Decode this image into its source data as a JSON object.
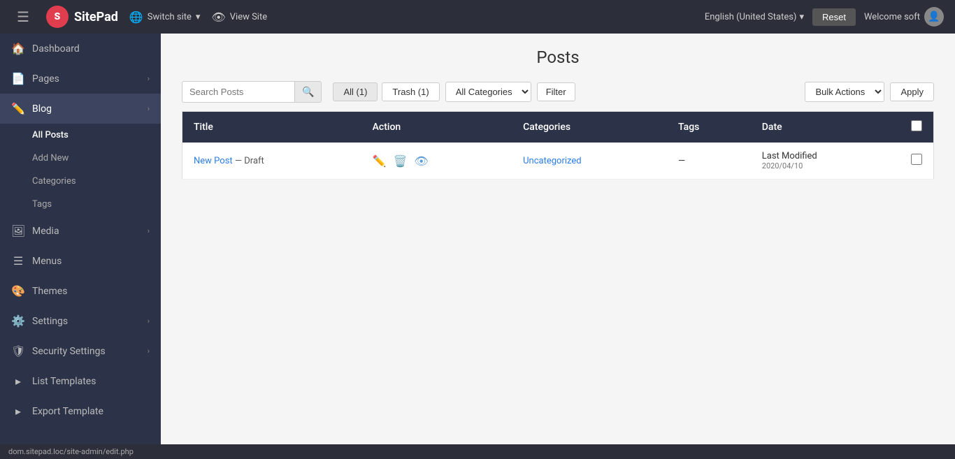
{
  "topnav": {
    "logo_text": "SitePad",
    "logo_letter": "S",
    "switch_site_label": "Switch site",
    "view_site_label": "View Site",
    "lang_label": "English (United States)",
    "reset_label": "Reset",
    "welcome_label": "Welcome soft"
  },
  "sidebar": {
    "items": [
      {
        "id": "dashboard",
        "icon": "🏠",
        "label": "Dashboard",
        "has_arrow": false
      },
      {
        "id": "pages",
        "icon": "📄",
        "label": "Pages",
        "has_arrow": true
      },
      {
        "id": "blog",
        "icon": "✏️",
        "label": "Blog",
        "has_arrow": true
      }
    ],
    "blog_sub": [
      {
        "id": "all-posts",
        "label": "All Posts",
        "active": true
      },
      {
        "id": "add-new",
        "label": "Add New"
      },
      {
        "id": "categories",
        "label": "Categories"
      },
      {
        "id": "tags",
        "label": "Tags"
      }
    ],
    "items2": [
      {
        "id": "media",
        "icon": "🖼",
        "label": "Media",
        "has_arrow": true
      },
      {
        "id": "menus",
        "icon": "☰",
        "label": "Menus",
        "has_arrow": false
      },
      {
        "id": "themes",
        "icon": "🎨",
        "label": "Themes",
        "has_arrow": false
      },
      {
        "id": "settings",
        "icon": "⚙️",
        "label": "Settings",
        "has_arrow": true
      },
      {
        "id": "security",
        "icon": "🛡",
        "label": "Security Settings",
        "has_arrow": true
      },
      {
        "id": "list-templates",
        "icon": "▸",
        "label": "List Templates",
        "has_arrow": false
      },
      {
        "id": "export-template",
        "icon": "▸",
        "label": "Export Template",
        "has_arrow": false
      }
    ]
  },
  "posts": {
    "page_title": "Posts",
    "search_placeholder": "Search Posts",
    "all_btn": "All",
    "all_count": "1",
    "trash_btn": "Trash",
    "trash_count": "1",
    "categories_default": "All Categories",
    "filter_btn": "Filter",
    "bulk_actions_default": "Bulk Actions",
    "apply_btn": "Apply",
    "columns": [
      "Title",
      "Action",
      "Categories",
      "Tags",
      "Date"
    ],
    "rows": [
      {
        "title": "New Post",
        "draft_label": "— Draft",
        "category": "Uncategorized",
        "tags": "—",
        "date_modified": "Last Modified",
        "date": "2020/04/10"
      }
    ]
  },
  "statusbar": {
    "url": "dom.sitepad.loc/site-admin/edit.php"
  }
}
